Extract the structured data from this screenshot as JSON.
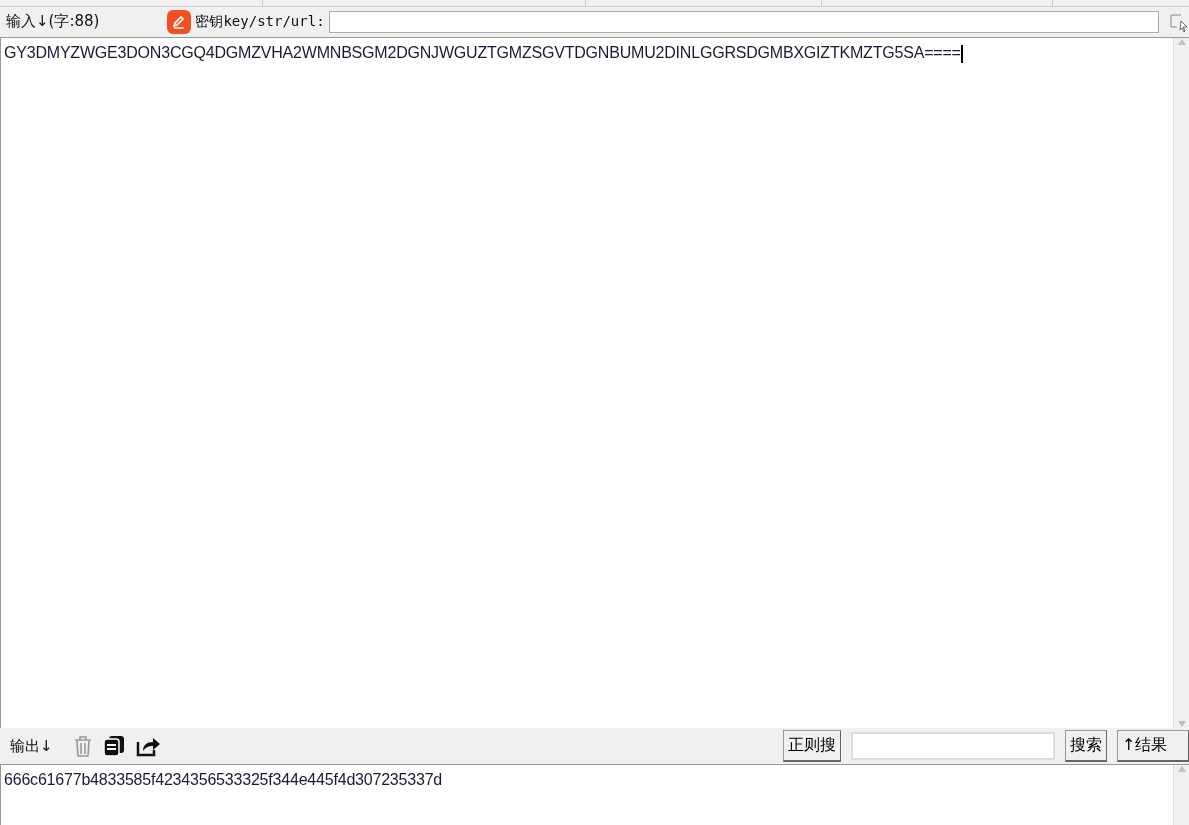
{
  "input_bar": {
    "label": "输入↓(字:88)",
    "key_label": "密钥key/str/url:"
  },
  "input_text": "GY3DMYZWGE3DON3CGQ4DGMZVHA2WMNBSGM2DGNJWGUZTGMZSGVTDGNBUMU2DINLGGRSDGMBXGIZTKMZTG5SA====",
  "output_bar": {
    "label": "输出↓",
    "regex_button": "正则搜",
    "search_button": "搜索",
    "result_button": "↑结果"
  },
  "output_text": "666c61677b4833585f4234356533325f344e445f4d307235337d"
}
